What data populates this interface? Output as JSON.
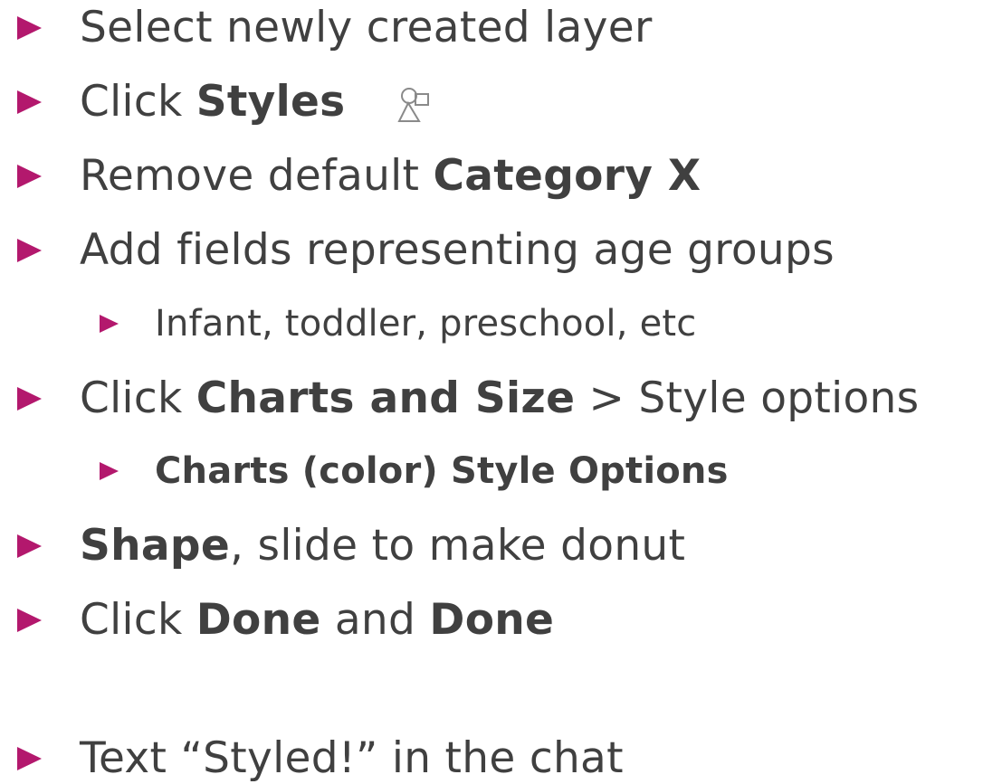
{
  "colors": {
    "bullet": "#b3186d",
    "text": "#404040"
  },
  "bullets": [
    {
      "parts": [
        "Select newly created layer"
      ]
    },
    {
      "plain": "Click ",
      "bold": "Styles",
      "icon": "styles-icon"
    },
    {
      "plain": "Remove default ",
      "bold": "Category X"
    },
    {
      "plain": "Add fields representing age groups"
    },
    {
      "plain": "Infant, toddler, preschool, etc"
    },
    {
      "plain": "Click ",
      "bold": "Charts and Size",
      "after": " > Style options"
    },
    {
      "bold": "Charts (color) Style Options"
    },
    {
      "bold": "Shape",
      "after": ", slide to make donut"
    },
    {
      "plain": "Click ",
      "bold": "Done",
      "mid": " and ",
      "bold2": "Done"
    },
    {
      "plain": "Text “Styled!” in the chat"
    }
  ]
}
